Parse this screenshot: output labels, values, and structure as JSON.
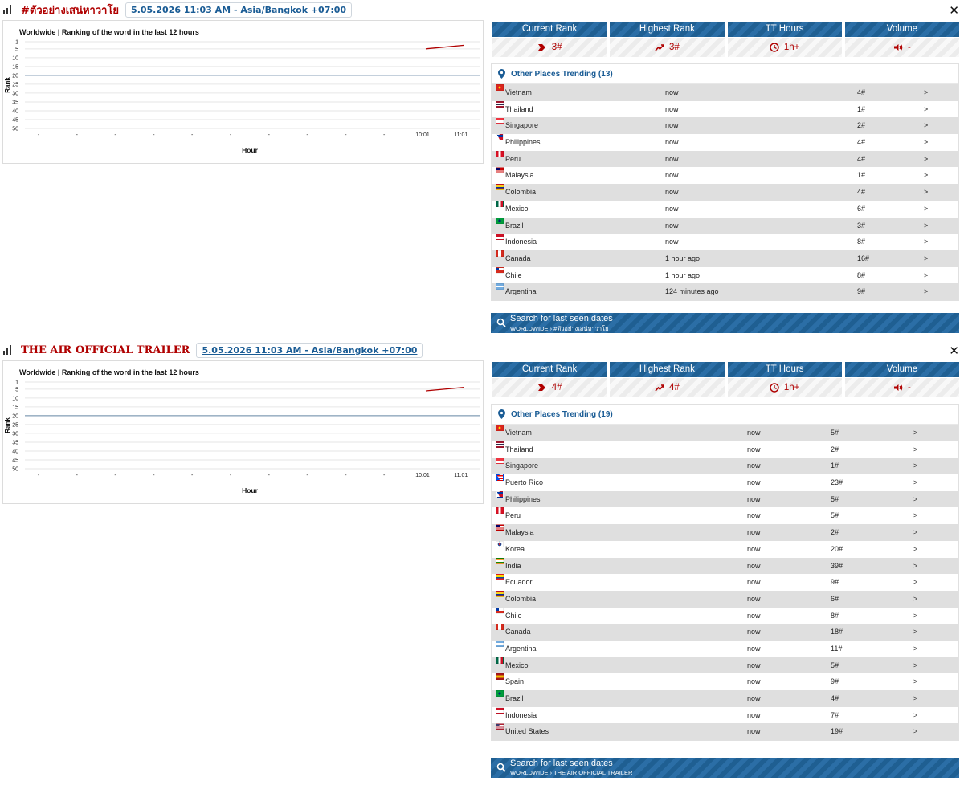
{
  "trends": [
    {
      "title": "#ตัวอย่างเสน่หาวาโย",
      "datetime": "5.05.2026 11:03 AM - Asia/Bangkok +07:00",
      "chart_title": "Worldwide | Ranking of the word in the last 12 hours",
      "stats": [
        {
          "label": "Current Rank",
          "value": "3#",
          "icon": "rank-arrow-icon"
        },
        {
          "label": "Highest Rank",
          "value": "3#",
          "icon": "trend-up-icon"
        },
        {
          "label": "TT Hours",
          "value": "1h+",
          "icon": "clock-icon"
        },
        {
          "label": "Volume",
          "value": "-",
          "icon": "speaker-icon"
        }
      ],
      "places_title": "Other Places Trending (13)",
      "places": [
        {
          "country": "Vietnam",
          "time": "now",
          "rank": "4#",
          "arrow": ">"
        },
        {
          "country": "Thailand",
          "time": "now",
          "rank": "1#",
          "arrow": ">"
        },
        {
          "country": "Singapore",
          "time": "now",
          "rank": "2#",
          "arrow": ">"
        },
        {
          "country": "Philippines",
          "time": "now",
          "rank": "4#",
          "arrow": ">"
        },
        {
          "country": "Peru",
          "time": "now",
          "rank": "4#",
          "arrow": ">"
        },
        {
          "country": "Malaysia",
          "time": "now",
          "rank": "1#",
          "arrow": ">"
        },
        {
          "country": "Colombia",
          "time": "now",
          "rank": "4#",
          "arrow": ">"
        },
        {
          "country": "Mexico",
          "time": "now",
          "rank": "6#",
          "arrow": ">"
        },
        {
          "country": "Brazil",
          "time": "now",
          "rank": "3#",
          "arrow": ">"
        },
        {
          "country": "Indonesia",
          "time": "now",
          "rank": "8#",
          "arrow": ">"
        },
        {
          "country": "Canada",
          "time": "1 hour ago",
          "rank": "16#",
          "arrow": ">"
        },
        {
          "country": "Chile",
          "time": "1 hour ago",
          "rank": "8#",
          "arrow": ">"
        },
        {
          "country": "Argentina",
          "time": "124 minutes ago",
          "rank": "9#",
          "arrow": ">"
        }
      ],
      "search_title": "Search for last seen dates",
      "search_sub": "WORLDWIDE › #ตัวอย่างเสน่หาวาโย"
    },
    {
      "title": "THE AIR OFFICIAL TRAILER",
      "datetime": "5.05.2026 11:03 AM - Asia/Bangkok +07:00",
      "chart_title": "Worldwide | Ranking of the word in the last 12 hours",
      "stats": [
        {
          "label": "Current Rank",
          "value": "4#",
          "icon": "rank-arrow-icon"
        },
        {
          "label": "Highest Rank",
          "value": "4#",
          "icon": "trend-up-icon"
        },
        {
          "label": "TT Hours",
          "value": "1h+",
          "icon": "clock-icon"
        },
        {
          "label": "Volume",
          "value": "-",
          "icon": "speaker-icon"
        }
      ],
      "places_title": "Other Places Trending (19)",
      "places": [
        {
          "country": "Vietnam",
          "time": "now",
          "rank": "5#",
          "arrow": ">"
        },
        {
          "country": "Thailand",
          "time": "now",
          "rank": "2#",
          "arrow": ">"
        },
        {
          "country": "Singapore",
          "time": "now",
          "rank": "1#",
          "arrow": ">"
        },
        {
          "country": "Puerto Rico",
          "time": "now",
          "rank": "23#",
          "arrow": ">"
        },
        {
          "country": "Philippines",
          "time": "now",
          "rank": "5#",
          "arrow": ">"
        },
        {
          "country": "Peru",
          "time": "now",
          "rank": "5#",
          "arrow": ">"
        },
        {
          "country": "Malaysia",
          "time": "now",
          "rank": "2#",
          "arrow": ">"
        },
        {
          "country": "Korea",
          "time": "now",
          "rank": "20#",
          "arrow": ">"
        },
        {
          "country": "India",
          "time": "now",
          "rank": "39#",
          "arrow": ">"
        },
        {
          "country": "Ecuador",
          "time": "now",
          "rank": "9#",
          "arrow": ">"
        },
        {
          "country": "Colombia",
          "time": "now",
          "rank": "6#",
          "arrow": ">"
        },
        {
          "country": "Chile",
          "time": "now",
          "rank": "8#",
          "arrow": ">"
        },
        {
          "country": "Canada",
          "time": "now",
          "rank": "18#",
          "arrow": ">"
        },
        {
          "country": "Argentina",
          "time": "now",
          "rank": "11#",
          "arrow": ">"
        },
        {
          "country": "Mexico",
          "time": "now",
          "rank": "5#",
          "arrow": ">"
        },
        {
          "country": "Spain",
          "time": "now",
          "rank": "9#",
          "arrow": ">"
        },
        {
          "country": "Brazil",
          "time": "now",
          "rank": "4#",
          "arrow": ">"
        },
        {
          "country": "Indonesia",
          "time": "now",
          "rank": "7#",
          "arrow": ">"
        },
        {
          "country": "United States",
          "time": "now",
          "rank": "19#",
          "arrow": ">"
        }
      ],
      "search_title": "Search for last seen dates",
      "search_sub": "WORLDWIDE › THE AIR OFFICIAL TRAILER"
    }
  ],
  "chart_data": [
    {
      "type": "line",
      "title": "Worldwide | Ranking of the word in the last 12 hours",
      "xlabel": "Hour",
      "ylabel": "Rank",
      "x": [
        "-",
        "-",
        "-",
        "-",
        "-",
        "-",
        "-",
        "-",
        "-",
        "-",
        "10:01",
        "11:01"
      ],
      "yticks": [
        "1",
        "5",
        "10",
        "15",
        "20",
        "25",
        "30",
        "35",
        "40",
        "45",
        "50"
      ],
      "ylim": [
        1,
        50
      ],
      "y_inverted": true,
      "grid": true,
      "reference_line_y": 20,
      "series": [
        {
          "values": [
            null,
            null,
            null,
            null,
            null,
            null,
            null,
            null,
            null,
            null,
            5,
            3
          ]
        }
      ],
      "colors": {
        "line": "#b00000",
        "reference": "#6a8aa8"
      }
    },
    {
      "type": "line",
      "title": "Worldwide | Ranking of the word in the last 12 hours",
      "xlabel": "Hour",
      "ylabel": "Rank",
      "x": [
        "-",
        "-",
        "-",
        "-",
        "-",
        "-",
        "-",
        "-",
        "-",
        "-",
        "10:01",
        "11:01"
      ],
      "yticks": [
        "1",
        "5",
        "10",
        "15",
        "20",
        "25",
        "30",
        "35",
        "40",
        "45",
        "50"
      ],
      "ylim": [
        1,
        50
      ],
      "y_inverted": true,
      "grid": true,
      "reference_line_y": 20,
      "series": [
        {
          "values": [
            null,
            null,
            null,
            null,
            null,
            null,
            null,
            null,
            null,
            null,
            6,
            4
          ]
        }
      ],
      "colors": {
        "line": "#b00000",
        "reference": "#6a8aa8"
      }
    }
  ]
}
